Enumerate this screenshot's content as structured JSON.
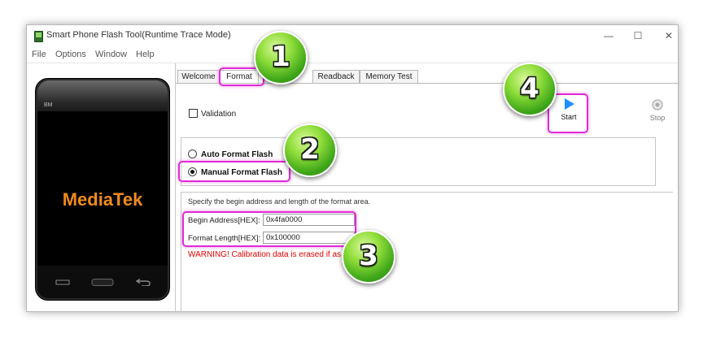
{
  "window": {
    "title": "Smart Phone Flash Tool(Runtime Trace Mode)",
    "controls": [
      "—",
      "☐",
      "✕"
    ]
  },
  "menu": [
    "File",
    "Options",
    "Window",
    "Help"
  ],
  "phone": {
    "brand": "MediaTek",
    "small_text": "BM",
    "brand_color": "#f08a1c"
  },
  "tabs": [
    {
      "label": "Welcome"
    },
    {
      "label": "Format",
      "active": true
    },
    {
      "label": "Readback"
    },
    {
      "label": "Memory Test"
    }
  ],
  "format": {
    "validation_label": "Validation",
    "start_label": "Start",
    "stop_label": "Stop",
    "auto_format_label": "Auto Format Flash",
    "manual_format_label": "Manual Format Flash",
    "hint": "Specify the begin address and length of the format area.",
    "begin_address_label": "Begin Address[HEX]:",
    "begin_address_value": "0x4fa0000",
    "format_length_label": "Format Length[HEX]:",
    "format_length_value": "0x100000",
    "warning": "WARNING! Calibration data is erased if                   as 0."
  },
  "badges": [
    "1",
    "2",
    "3",
    "4"
  ],
  "colors": {
    "highlight": "#e02ad6",
    "warning": "#e00000",
    "start_icon": "#1e90ff",
    "badge_green": "#5cc226"
  }
}
